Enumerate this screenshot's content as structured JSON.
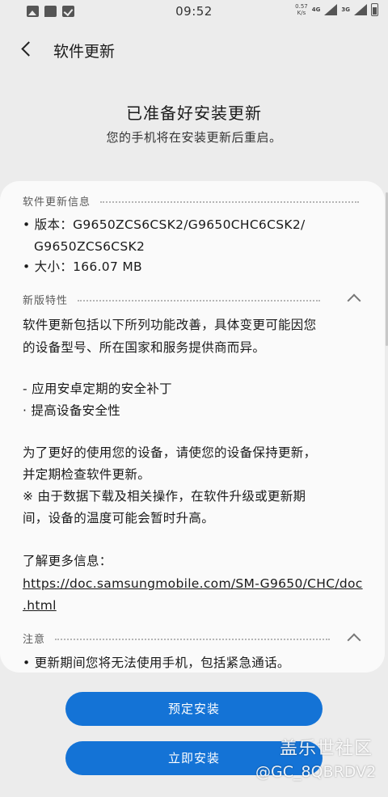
{
  "status_bar": {
    "time": "09:52",
    "net_speed_value": "0.57",
    "net_speed_unit": "K/s",
    "network": "4G",
    "network2": "3G"
  },
  "header": {
    "title": "软件更新"
  },
  "headline": "已准备好安装更新",
  "subline": "您的手机将在安装更新后重启。",
  "info": {
    "title": "软件更新信息",
    "version_line1": "• 版本：G9650ZCS6CSK2/G9650CHC6CSK2/",
    "version_line2": "G9650ZCS6CSK2",
    "size_line": "• 大小：166.07 MB"
  },
  "features": {
    "title": "新版特性",
    "lines": [
      "软件更新包括以下所列功能改善，具体变更可能因您",
      "的设备型号、所在国家和服务提供商而异。",
      "- 应用安卓定期的安全补丁",
      "· 提高设备安全性",
      "为了更好的使用您的设备，请使您的设备保持更新，",
      "并定期检查软件更新。",
      "※ 由于数据下载及相关操作，在软件升级或更新期",
      "间，设备的温度可能会暂时升高。",
      "了解更多信息：",
      "https://doc.samsungmobile.com/SM-G9650/CHC/doc",
      ".html"
    ]
  },
  "notice": {
    "title": "注意",
    "line": "• 更新期间您将无法使用手机，包括紧急通话。"
  },
  "buttons": {
    "schedule": "预定安装",
    "install_now": "立即安装"
  },
  "watermark": {
    "line1": "盖乐世社区",
    "line2": "@GC_8QBRDV2"
  }
}
